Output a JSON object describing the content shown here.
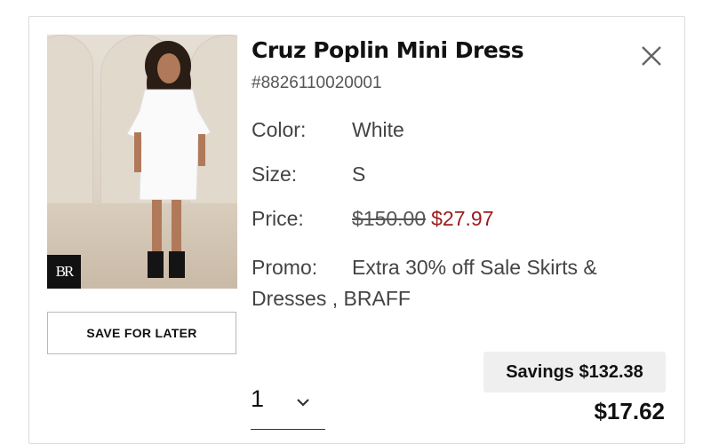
{
  "product": {
    "title": "Cruz Poplin Mini Dress",
    "sku": "#8826110020001",
    "image_alt": "model wearing white poplin mini dress",
    "brand_logo_text": "BR"
  },
  "attributes": {
    "color_label": "Color:",
    "color_value": "White",
    "size_label": "Size:",
    "size_value": "S",
    "price_label": "Price:",
    "original_price": "$150.00",
    "sale_price": "$27.97",
    "promo_label": "Promo:",
    "promo_value": "Extra 30% off Sale Skirts & Dresses , BRAFF"
  },
  "actions": {
    "save_for_later": "SAVE FOR LATER"
  },
  "quantity": {
    "selected": "1"
  },
  "summary": {
    "savings": "Savings $132.38",
    "total": "$17.62"
  },
  "colors": {
    "sale_price": "#9b1c1c",
    "savings_badge_bg": "#efefef"
  },
  "icons": {
    "close": "close-icon",
    "quantity_dropdown": "chevron-down-icon"
  }
}
